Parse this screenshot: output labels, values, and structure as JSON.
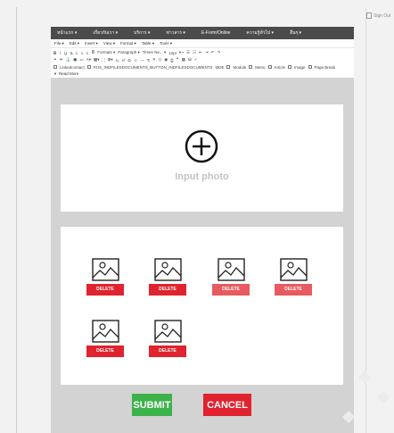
{
  "signout": {
    "label": "Sign Out"
  },
  "nav": {
    "items": [
      "หน้าแรก ▾",
      "เกี่ยวกับเรา ▾",
      "บริการ ▾",
      "ข่าวสาร ▾",
      "E-Form/Online",
      "ความรู้ทั่วไป ▾",
      "อื่นๆ ▾"
    ]
  },
  "menubar": {
    "items": [
      "File ▾",
      "Edit ▾",
      "Insert ▾",
      "View ▾",
      "Format ▾",
      "Table ▾",
      "Tools ▾"
    ]
  },
  "toolbar": {
    "format_label": "Formats ▾",
    "paragraph_label": "Paragraph ▾",
    "font_label": "Times Ne... ▾",
    "size_label": "12pt",
    "pdf_button": "PUS_INDFILESDOCUMENTS_BUTTON_INDFILESDOCUMENTS",
    "module_label": "Module",
    "menu_label": "Menu",
    "article_label": "Article",
    "image_label": "Image",
    "pagebreak_label": "Page Break",
    "contact_label": "Linkedcontact",
    "mode_label": "MDE",
    "readmore_label": "Read More"
  },
  "photo": {
    "label": "Input photo"
  },
  "gallery": {
    "delete_label": "DELETE",
    "items": [
      {
        "state": "active"
      },
      {
        "state": "active"
      },
      {
        "state": "dim"
      },
      {
        "state": "dim"
      },
      {
        "state": "active"
      },
      {
        "state": "active"
      }
    ]
  },
  "actions": {
    "submit_label": "SUBMIT",
    "cancel_label": "CANCEL"
  },
  "colors": {
    "nav_bg": "#4b4b4b",
    "danger": "#e0232e",
    "success": "#3cb34a",
    "panel_bg": "#d3d3d3"
  }
}
